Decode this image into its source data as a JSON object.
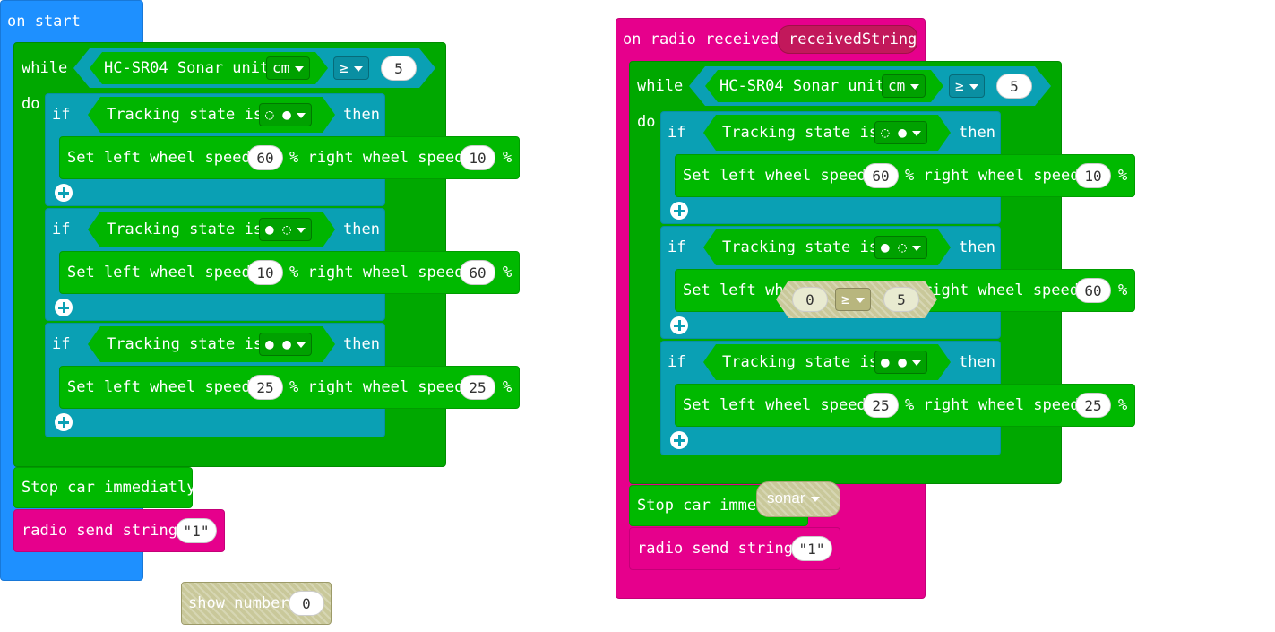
{
  "colors": {
    "event_blue": "#1e90ff",
    "radio_pink": "#e6008c",
    "loop_green": "#00a800",
    "logic_teal": "#0aa0b4",
    "ghost": "#c9c89a"
  },
  "on_start": {
    "header": "on start",
    "while_label": "while",
    "do_label": "do",
    "sonar_label": "HC-SR04 Sonar unit",
    "unit": "cm",
    "operator": "≥",
    "threshold": "5",
    "ifs": [
      {
        "if_label": "if",
        "cond": "Tracking state is",
        "state": "◌ ●",
        "then": "then",
        "set": "Set left wheel speed",
        "left": "60",
        "mid": "% right wheel speed",
        "right": "10",
        "pct": "%"
      },
      {
        "if_label": "if",
        "cond": "Tracking state is",
        "state": "● ◌",
        "then": "then",
        "set": "Set left wheel speed",
        "left": "10",
        "mid": "% right wheel speed",
        "right": "60",
        "pct": "%"
      },
      {
        "if_label": "if",
        "cond": "Tracking state is",
        "state": "● ●",
        "then": "then",
        "set": "Set left wheel speed",
        "left": "25",
        "mid": "% right wheel speed",
        "right": "25",
        "pct": "%"
      }
    ],
    "stop": "Stop car immediatly",
    "radio_send": "radio send string",
    "radio_value": "\"1\""
  },
  "show_number": {
    "label": "show number",
    "value": "0"
  },
  "on_radio": {
    "header": "on radio received",
    "param": "receivedString",
    "while_label": "while",
    "do_label": "do",
    "sonar_label": "HC-SR04 Sonar unit",
    "unit": "cm",
    "operator": "≥",
    "threshold": "5",
    "ifs": [
      {
        "if_label": "if",
        "cond": "Tracking state is",
        "state": "◌ ●",
        "then": "then",
        "set": "Set left wheel speed",
        "left": "60",
        "mid": "% right wheel speed",
        "right": "10",
        "pct": "%"
      },
      {
        "if_label": "if",
        "cond": "Tracking state is",
        "state": "● ◌",
        "then": "then",
        "set": "Set left whe",
        "mid": "right wheel speed",
        "right": "60",
        "pct": "%"
      },
      {
        "if_label": "if",
        "cond": "Tracking state is",
        "state": "● ●",
        "then": "then",
        "set": "Set left wheel speed",
        "left": "25",
        "mid": "% right wheel speed",
        "right": "25",
        "pct": "%"
      }
    ],
    "stop": "Stop car immediatly",
    "radio_send": "radio send string",
    "radio_value": "\"1\""
  },
  "floating_compare": {
    "left": "0",
    "operator": "≥",
    "right": "5"
  },
  "floating_var": {
    "label": "sonar"
  }
}
